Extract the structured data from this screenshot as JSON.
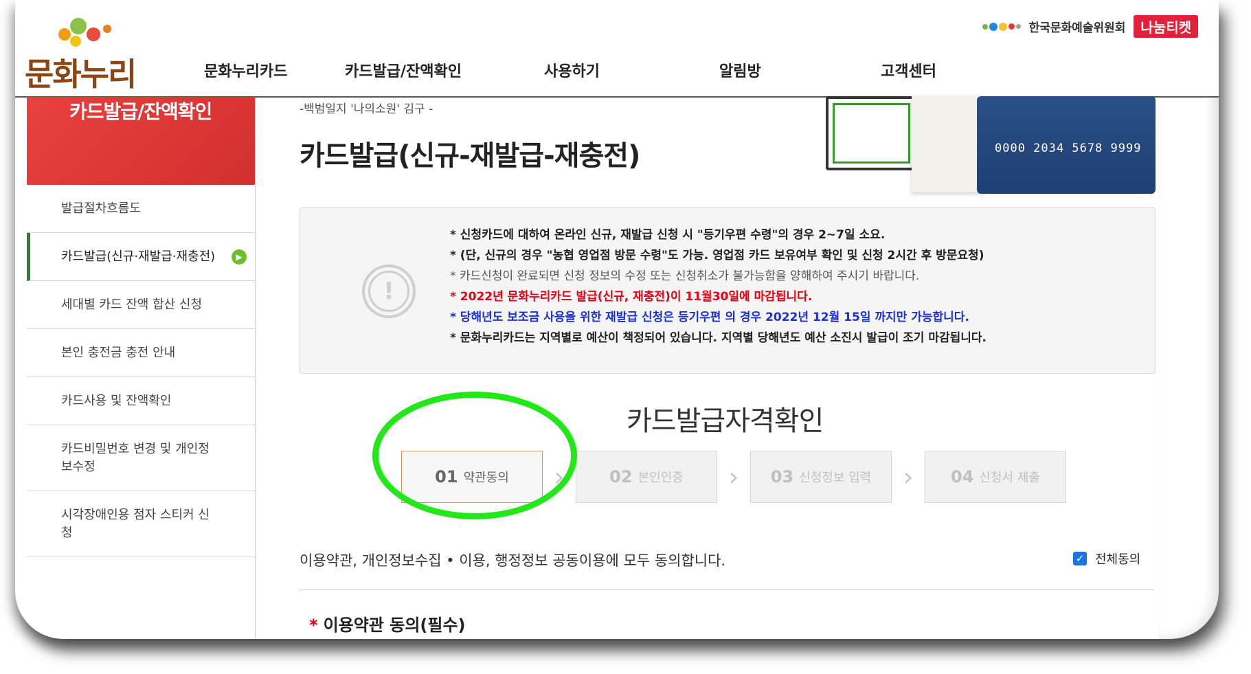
{
  "header": {
    "logo_text": "문화누리",
    "nav": [
      "문화누리카드",
      "카드발급/잔액확인",
      "사용하기",
      "알림방",
      "고객센터"
    ],
    "org_name": "한국문화예술위원회",
    "nanum_logo": "나눔티켓"
  },
  "sidebar": {
    "banner_title": "카드발급/잔액확인",
    "items": [
      {
        "label": "발급절차흐름도"
      },
      {
        "label": "카드발급(신규·재발급·재충전)"
      },
      {
        "label": "세대별 카드 잔액 합산 신청"
      },
      {
        "label": "본인 충전금 충전 안내"
      },
      {
        "label": "카드사용 및 잔액확인"
      },
      {
        "label": "카드비밀번호 변경 및 개인정보수정"
      },
      {
        "label": "시각장애인용 점자 스티커 신청"
      }
    ]
  },
  "main": {
    "quote": "-백범일지 '나의소원' 김구 -",
    "title": "카드발급(신규-재발급-재충전)",
    "card_number": "0000 2034 5678 9999",
    "notice": [
      "* 신청카드에 대하여 온라인 신규, 재발급 신청 시 \"등기우편 수령\"의 경우 2~7일 소요.",
      "* (단, 신규의 경우 \"농협 영업점 방문 수령\"도 가능. 영업점 카드 보유여부 확인 및 신청 2시간 후 방문요청)",
      "* 카드신청이 완료되면 신청 정보의 수정 또는 신청취소가 불가능함을 양해하여 주시기 바랍니다.",
      "* 2022년 문화누리카드 발급(신규, 재충전)이 11월30일에 마감됩니다.",
      "* 당해년도 보조금 사용을 위한 재발급 신청은 등기우편 의 경우 2022년 12월 15일 까지만 가능합니다.",
      "* 문화누리카드는 지역별로 예산이 책정되어 있습니다. 지역별 당해년도 예산 소진시 발급이 조기 마감됩니다."
    ],
    "section_title": "카드발급자격확인",
    "steps": [
      {
        "num": "01",
        "label": "약관동의"
      },
      {
        "num": "02",
        "label": "본인인증"
      },
      {
        "num": "03",
        "label": "신청정보 입력"
      },
      {
        "num": "04",
        "label": "신청서 제출"
      }
    ],
    "agree_text": "이용약관, 개인정보수집 • 이용, 행정정보 공동이용에 모두 동의합니다.",
    "agree_all_label": "전체동의",
    "agree_all_checked": true,
    "terms_title": "이용약관 동의(필수)"
  },
  "colors": {
    "accent_red": "#e3213a",
    "active_green": "#2e7d32",
    "highlight_ring": "#22e81a",
    "notice_red": "#e60012",
    "notice_blue": "#1a2fd6"
  }
}
